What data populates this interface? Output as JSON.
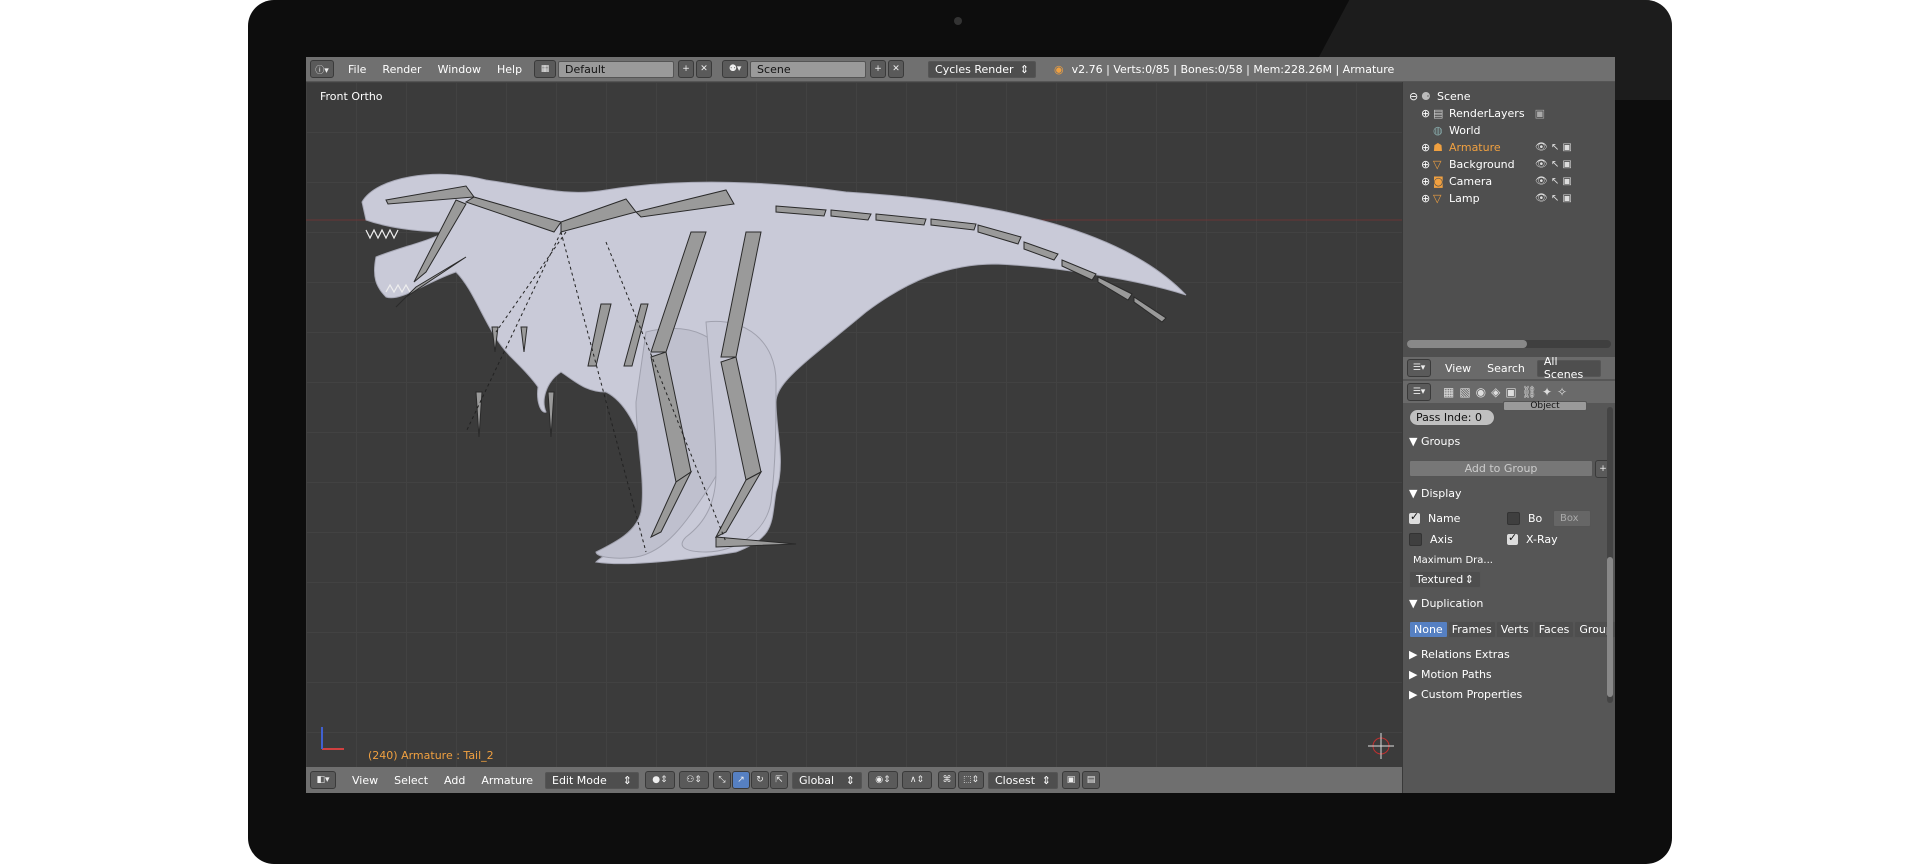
{
  "top_menu": {
    "file": "File",
    "render": "Render",
    "window": "Window",
    "help": "Help"
  },
  "layout": {
    "name": "Default"
  },
  "scene": {
    "name": "Scene"
  },
  "engine": {
    "name": "Cycles Render"
  },
  "stats": "v2.76 | Verts:0/85 | Bones:0/58 | Mem:228.26M | Armature",
  "viewport": {
    "view_label": "Front Ortho",
    "status": "(240) Armature : Tail_2"
  },
  "bottom_bar": {
    "view": "View",
    "select": "Select",
    "add": "Add",
    "armature": "Armature",
    "mode": "Edit Mode",
    "orientation": "Global",
    "snap": "Closest"
  },
  "outliner": {
    "items": [
      {
        "label": "Scene"
      },
      {
        "label": "RenderLayers"
      },
      {
        "label": "World"
      },
      {
        "label": "Armature"
      },
      {
        "label": "Background"
      },
      {
        "label": "Camera"
      },
      {
        "label": "Lamp"
      }
    ],
    "view": "View",
    "search": "Search",
    "filter": "All Scenes"
  },
  "properties": {
    "object_tab": "Object",
    "pass_index": "Pass Inde: 0",
    "groups_header": "Groups",
    "add_to_group": "Add to Group",
    "display_header": "Display",
    "name_label": "Name",
    "bo_label": "Bo",
    "box_label": "Box",
    "axis_label": "Axis",
    "xray_label": "X-Ray",
    "max_draw_label": "Maximum Dra...",
    "max_draw_value": "Textured",
    "duplication_header": "Duplication",
    "dup_tabs": [
      "None",
      "Frames",
      "Verts",
      "Faces",
      "Group"
    ],
    "relations_extras": "Relations Extras",
    "motion_paths": "Motion Paths",
    "custom_properties": "Custom Properties"
  },
  "colors": {
    "selected": "#5680c2",
    "bone": "#9a9a9a",
    "model": "#c9cad8",
    "status_orange": "#f0a040"
  }
}
